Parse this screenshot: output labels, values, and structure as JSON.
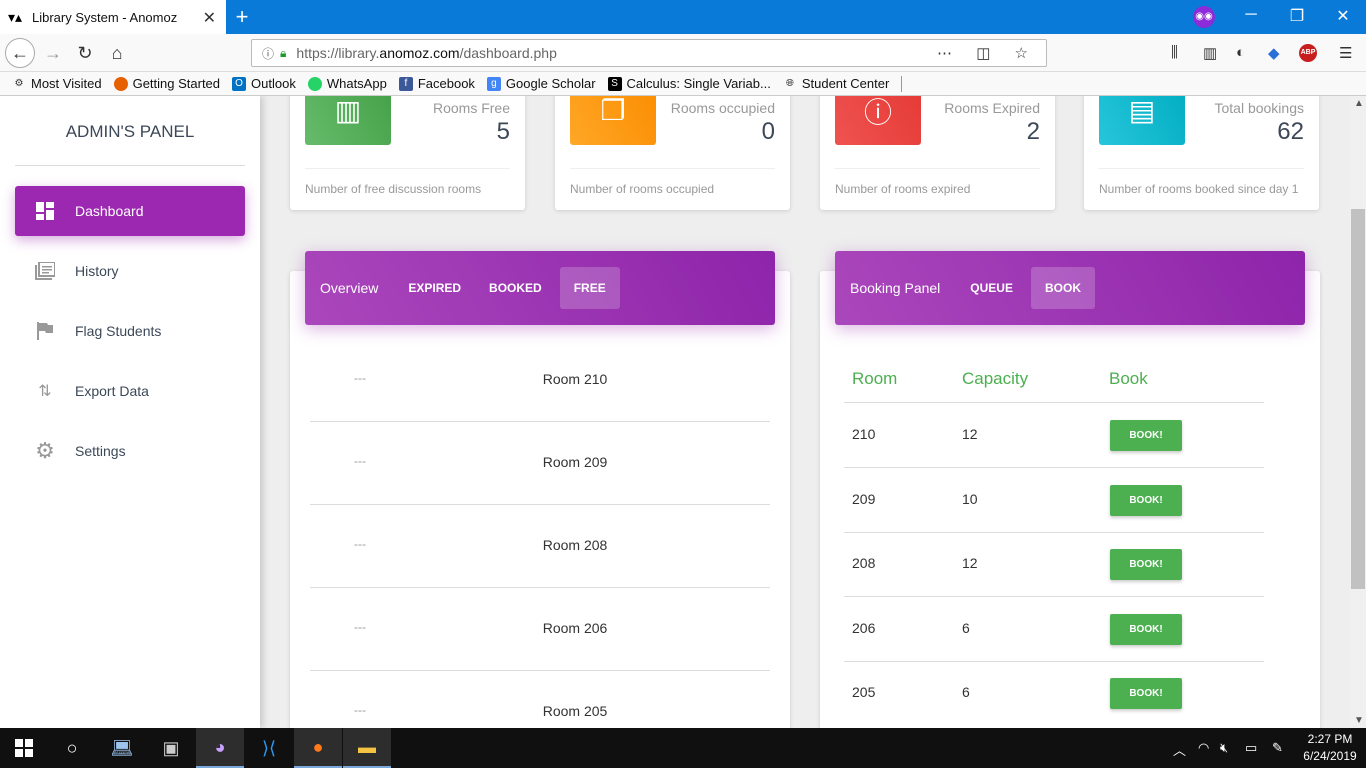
{
  "browser": {
    "tab_title": "Library System - Anomoz",
    "url_prefix": "https://library.",
    "url_domain": "anomoz.com",
    "url_path": "/dashboard.php",
    "bookmarks": [
      "Most Visited",
      "Getting Started",
      "Outlook",
      "WhatsApp",
      "Facebook",
      "Google Scholar",
      "Calculus: Single Variab...",
      "Student Center"
    ]
  },
  "sidebar": {
    "title": "ADMIN'S PANEL",
    "items": [
      {
        "label": "Dashboard",
        "icon": "dashboard-icon",
        "active": true
      },
      {
        "label": "History",
        "icon": "history-icon"
      },
      {
        "label": "Flag Students",
        "icon": "flag-icon"
      },
      {
        "label": "Export Data",
        "icon": "export-icon"
      },
      {
        "label": "Settings",
        "icon": "gear-icon"
      }
    ]
  },
  "stats": [
    {
      "label": "Rooms Free",
      "value": "5",
      "footer": "Number of free discussion rooms",
      "color": "#4caf50"
    },
    {
      "label": "Rooms occupied",
      "value": "0",
      "footer": "Number of rooms occupied",
      "color": "#ff9800"
    },
    {
      "label": "Rooms Expired",
      "value": "2",
      "footer": "Number of rooms expired",
      "color": "#f44336"
    },
    {
      "label": "Total bookings",
      "value": "62",
      "footer": "Number of rooms booked since day 1",
      "color": "#00bcd4"
    }
  ],
  "overview": {
    "title": "Overview",
    "tabs": [
      "EXPIRED",
      "BOOKED",
      "FREE"
    ],
    "active_tab": "FREE",
    "rows": [
      {
        "dash": "---",
        "room": "Room 210"
      },
      {
        "dash": "---",
        "room": "Room 209"
      },
      {
        "dash": "---",
        "room": "Room 208"
      },
      {
        "dash": "---",
        "room": "Room 206"
      },
      {
        "dash": "---",
        "room": "Room 205"
      }
    ]
  },
  "booking": {
    "title": "Booking Panel",
    "tabs": [
      "QUEUE",
      "BOOK"
    ],
    "active_tab": "BOOK",
    "columns": [
      "Room",
      "Capacity",
      "Book"
    ],
    "button_label": "BOOK!",
    "rows": [
      {
        "room": "210",
        "capacity": "12"
      },
      {
        "room": "209",
        "capacity": "10"
      },
      {
        "room": "208",
        "capacity": "12"
      },
      {
        "room": "206",
        "capacity": "6"
      },
      {
        "room": "205",
        "capacity": "6"
      }
    ]
  },
  "taskbar": {
    "time": "2:27 PM",
    "date": "6/24/2019"
  },
  "colors": {
    "accent": "#9c27b0",
    "success": "#4caf50",
    "browser_blue": "#0a7ad8"
  }
}
